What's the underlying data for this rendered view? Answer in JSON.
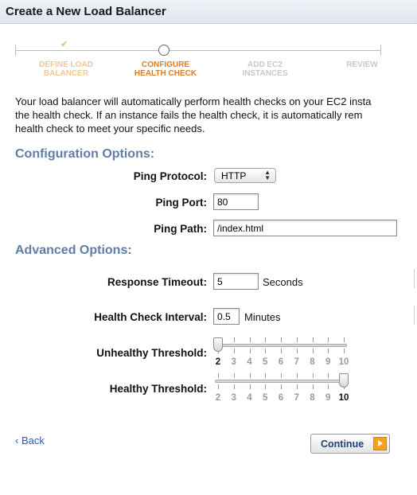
{
  "dialog": {
    "title": "Create a New Load Balancer"
  },
  "wizard": {
    "steps": [
      {
        "line1": "DEFINE LOAD",
        "line2": "BALANCER",
        "state": "done"
      },
      {
        "line1": "CONFIGURE",
        "line2": "HEALTH CHECK",
        "state": "current"
      },
      {
        "line1": "ADD EC2",
        "line2": "INSTANCES",
        "state": "pending"
      },
      {
        "line1": "REVIEW",
        "line2": "",
        "state": "pending"
      }
    ],
    "done_mark": "✔"
  },
  "intro": {
    "line1": "Your load balancer will automatically perform health checks on your EC2 insta",
    "line2": "the health check. If an instance fails the health check, it is automatically rem",
    "line3": "health check to meet your specific needs."
  },
  "config": {
    "heading": "Configuration Options:",
    "ping_protocol": {
      "label": "Ping Protocol:",
      "value": "HTTP"
    },
    "ping_port": {
      "label": "Ping Port:",
      "value": "80"
    },
    "ping_path": {
      "label": "Ping Path:",
      "value": "/index.html"
    }
  },
  "advanced": {
    "heading": "Advanced Options:",
    "response_timeout": {
      "label": "Response Timeout:",
      "value": "5",
      "unit": "Seconds"
    },
    "interval": {
      "label": "Health Check Interval:",
      "value": "0.5",
      "unit": "Minutes"
    },
    "unhealthy": {
      "label": "Unhealthy Threshold:",
      "min": 2,
      "max": 10,
      "value": 2,
      "ticks": [
        "2",
        "3",
        "4",
        "5",
        "6",
        "7",
        "8",
        "9",
        "10"
      ]
    },
    "healthy": {
      "label": "Healthy Threshold:",
      "min": 2,
      "max": 10,
      "value": 10,
      "ticks": [
        "2",
        "3",
        "4",
        "5",
        "6",
        "7",
        "8",
        "9",
        "10"
      ]
    }
  },
  "footer": {
    "back": "‹ Back",
    "continue": "Continue"
  },
  "colors": {
    "section": "#5f7ea6",
    "active_step": "#e07b1c",
    "link": "#2b5bb7",
    "continue_icon": "#f7a21b"
  }
}
